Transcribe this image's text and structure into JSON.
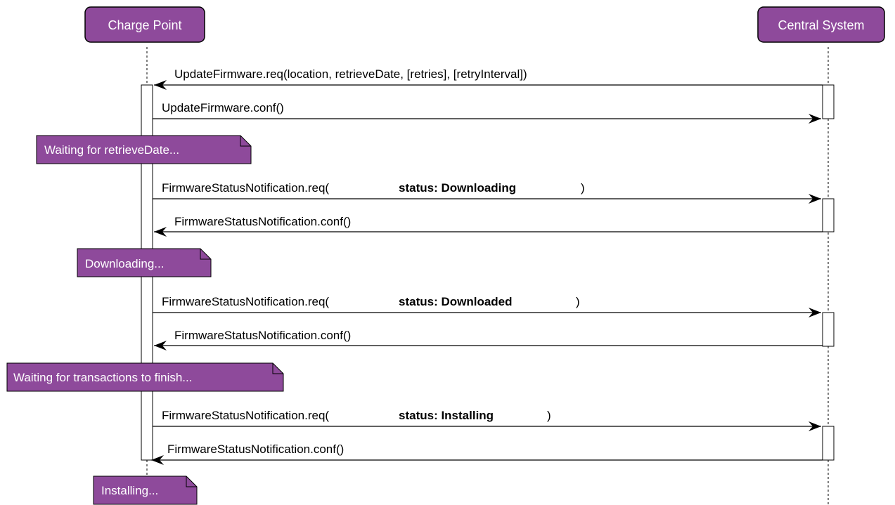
{
  "actors": {
    "left": "Charge Point",
    "right": "Central System"
  },
  "colors": {
    "actor_fill": "#8e4a9b",
    "actor_stroke": "#000000",
    "note_fill": "#8e4a9b",
    "line": "#000000"
  },
  "messages": [
    {
      "label": "UpdateFirmware.req(location, retrieveDate, [retries], [retryInterval])",
      "direction": "to-left"
    },
    {
      "label": "UpdateFirmware.conf()",
      "direction": "to-right"
    },
    {
      "prefix": "FirmwareStatusNotification.req(",
      "status": "status: Downloading",
      "suffix": ")",
      "direction": "to-right"
    },
    {
      "label": "FirmwareStatusNotification.conf()",
      "direction": "to-left"
    },
    {
      "prefix": "FirmwareStatusNotification.req(",
      "status": "status: Downloaded",
      "suffix": ")",
      "direction": "to-right"
    },
    {
      "label": "FirmwareStatusNotification.conf()",
      "direction": "to-left"
    },
    {
      "prefix": "FirmwareStatusNotification.req(",
      "status": "status: Installing",
      "suffix": ")",
      "direction": "to-right"
    },
    {
      "label": "FirmwareStatusNotification.conf()",
      "direction": "to-left"
    }
  ],
  "notes": [
    "Waiting for retrieveDate...",
    "Downloading...",
    "Waiting for transactions to finish...",
    "Installing..."
  ]
}
